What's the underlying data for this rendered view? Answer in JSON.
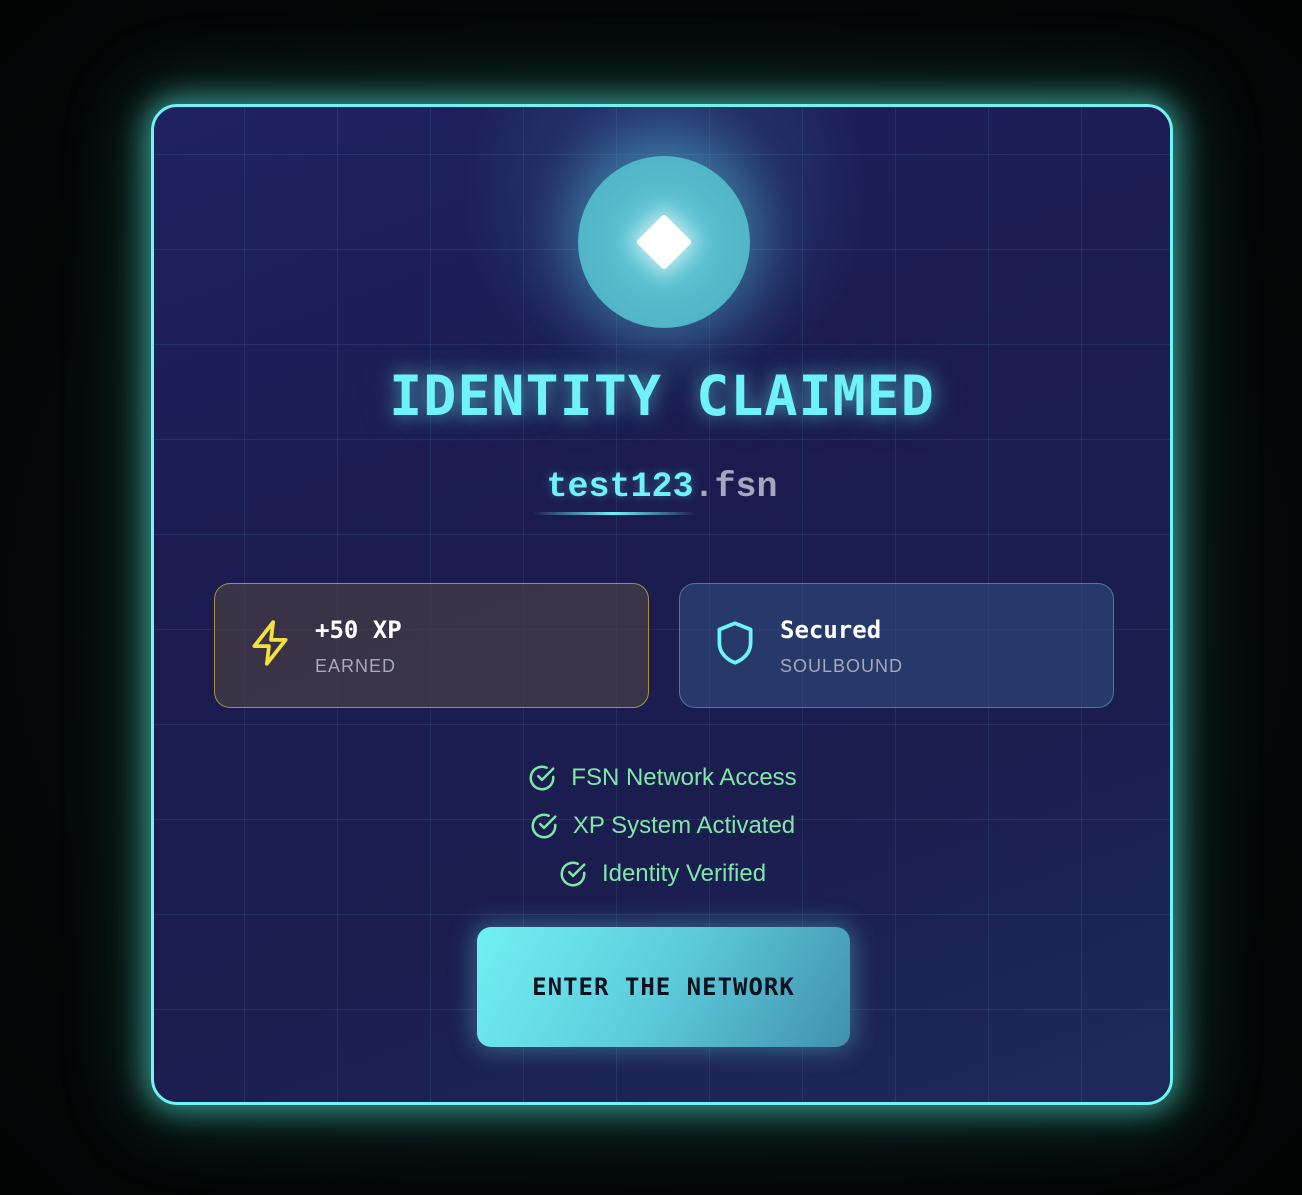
{
  "card": {
    "title": "IDENTITY CLAIMED",
    "domain": {
      "name": "test123",
      "tld": ".fsn"
    },
    "emblem_icon": "diamond-icon"
  },
  "stats": [
    {
      "value": "+50 XP",
      "label": "EARNED",
      "icon": "lightning-bolt-icon",
      "accent": "#f4e23a"
    },
    {
      "value": "Secured",
      "label": "SOULBOUND",
      "icon": "shield-icon",
      "accent": "#6ff3f8"
    }
  ],
  "checklist": [
    {
      "label": "FSN Network Access",
      "icon": "check-circle-icon"
    },
    {
      "label": "XP System Activated",
      "icon": "check-circle-icon"
    },
    {
      "label": "Identity Verified",
      "icon": "check-circle-icon"
    }
  ],
  "cta": {
    "label": "ENTER THE NETWORK"
  },
  "colors": {
    "accent": "#6ff3f8",
    "success": "#7ee9a6",
    "xp": "#f4e23a"
  }
}
